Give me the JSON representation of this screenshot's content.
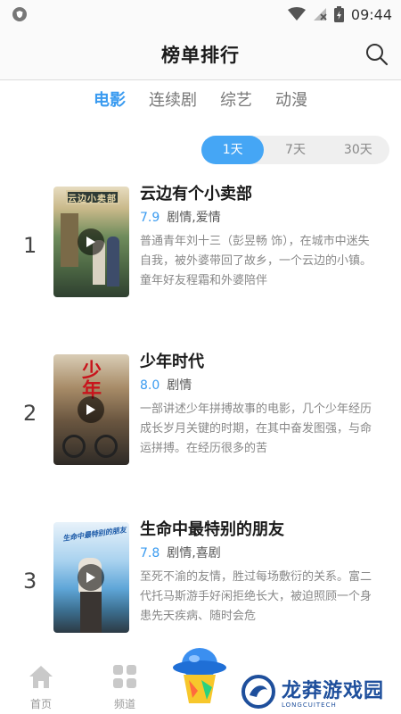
{
  "status_bar": {
    "time": "09:44",
    "icons": [
      "shield-icon",
      "wifi-icon",
      "no-signal-icon",
      "battery-icon"
    ]
  },
  "header": {
    "title": "榜单排行",
    "search_icon": "search-icon"
  },
  "category_tabs": [
    {
      "label": "电影",
      "active": true
    },
    {
      "label": "连续剧",
      "active": false
    },
    {
      "label": "综艺",
      "active": false
    },
    {
      "label": "动漫",
      "active": false
    }
  ],
  "range_options": [
    {
      "label": "1天",
      "active": true
    },
    {
      "label": "7天",
      "active": false
    },
    {
      "label": "30天",
      "active": false
    }
  ],
  "items": [
    {
      "rank": "1",
      "title": "云边有个小卖部",
      "score": "7.9",
      "genre": "剧情,爱情",
      "desc": "普通青年刘十三（彭昱畅 饰），在城市中迷失自我，被外婆带回了故乡，一个云边的小镇。童年好友程霜和外婆陪伴",
      "poster_text": "云边有个小卖部",
      "poster_colors": [
        "#5b7a4e",
        "#c9b98a"
      ]
    },
    {
      "rank": "2",
      "title": "少年时代",
      "score": "8.0",
      "genre": "剧情",
      "desc": "一部讲述少年拼搏故事的电影，几个少年经历成长岁月关键的时期，在其中奋发图强，与命运拼搏。在经历很多的苦",
      "poster_text": "少年时代",
      "poster_colors": [
        "#8a6a4a",
        "#3e3a36"
      ]
    },
    {
      "rank": "3",
      "title": "生命中最特别的朋友",
      "score": "7.8",
      "genre": "剧情,喜剧",
      "desc": "至死不渝的友情，胜过每场敷衍的关系。富二代托马斯游手好闲拒绝长大，被迫照顾一个身患先天疾病、随时会危",
      "poster_text": "生命中最特别的朋友",
      "poster_colors": [
        "#6fb2e0",
        "#dcecf7"
      ]
    }
  ],
  "bottom_nav": [
    {
      "label": "首页",
      "icon": "home-icon"
    },
    {
      "label": "频道",
      "icon": "grid-icon"
    }
  ],
  "watermark": {
    "title": "龙莽游戏园",
    "subtitle": "LONGCUITECH"
  },
  "colors": {
    "accent": "#3a9bf0",
    "range_active": "#45a6f5"
  }
}
